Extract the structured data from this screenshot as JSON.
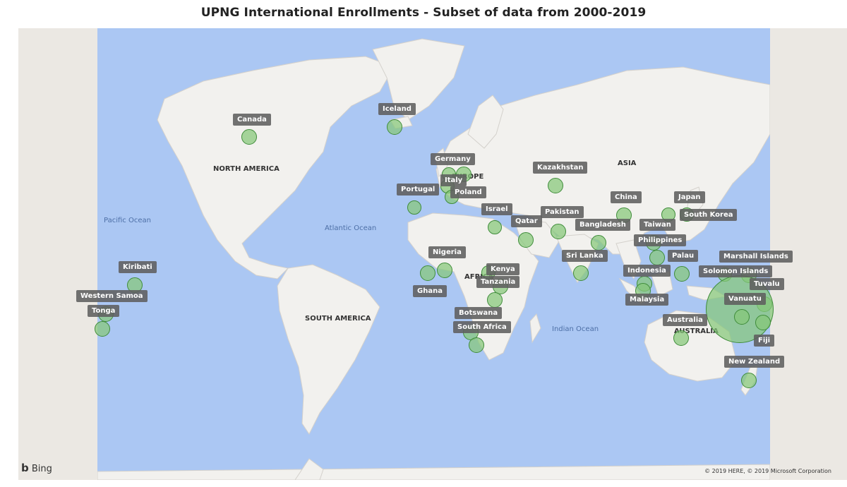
{
  "title": "UPNG International Enrollments - Subset of data from 2000-2019",
  "colors": {
    "ocean": "#abc7f3",
    "land": "#f2f1ee",
    "frame": "#ebe8e3",
    "bubble_fill": "#85c878",
    "bubble_stroke": "#3f8c3a",
    "tag_bg": "#5f5f5f"
  },
  "region_labels": {
    "north_america": "NORTH AMERICA",
    "south_america": "SOUTH AMERICA",
    "europe": "EUROPE",
    "africa": "AFRICA",
    "asia": "ASIA",
    "australia": "AUSTRALIA"
  },
  "ocean_labels": {
    "pacific": "Pacific Ocean",
    "atlantic": "Atlantic Ocean",
    "indian": "Indian Ocean"
  },
  "countries": [
    {
      "name": "Canada"
    },
    {
      "name": "Iceland"
    },
    {
      "name": "Germany"
    },
    {
      "name": "Italy"
    },
    {
      "name": "Poland"
    },
    {
      "name": "Portugal"
    },
    {
      "name": "Kazakhstan"
    },
    {
      "name": "China"
    },
    {
      "name": "Japan"
    },
    {
      "name": "South Korea"
    },
    {
      "name": "Israel"
    },
    {
      "name": "Qatar"
    },
    {
      "name": "Pakistan"
    },
    {
      "name": "Bangladesh"
    },
    {
      "name": "Taiwan"
    },
    {
      "name": "Philippines"
    },
    {
      "name": "Nigeria"
    },
    {
      "name": "Ghana"
    },
    {
      "name": "Kenya"
    },
    {
      "name": "Tanzania"
    },
    {
      "name": "Botswana"
    },
    {
      "name": "South Africa"
    },
    {
      "name": "Sri Lanka"
    },
    {
      "name": "Indonesia"
    },
    {
      "name": "Malaysia"
    },
    {
      "name": "Palau"
    },
    {
      "name": "Marshall Islands"
    },
    {
      "name": "Solomon Islands"
    },
    {
      "name": "Tuvalu"
    },
    {
      "name": "Vanuatu"
    },
    {
      "name": "Fiji"
    },
    {
      "name": "Australia"
    },
    {
      "name": "New Zealand"
    },
    {
      "name": "Kiribati"
    },
    {
      "name": "Western Samoa"
    },
    {
      "name": "Tonga"
    }
  ],
  "attribution": {
    "logo": "Bing",
    "copyright": "© 2019 HERE, © 2019 Microsoft Corporation"
  }
}
